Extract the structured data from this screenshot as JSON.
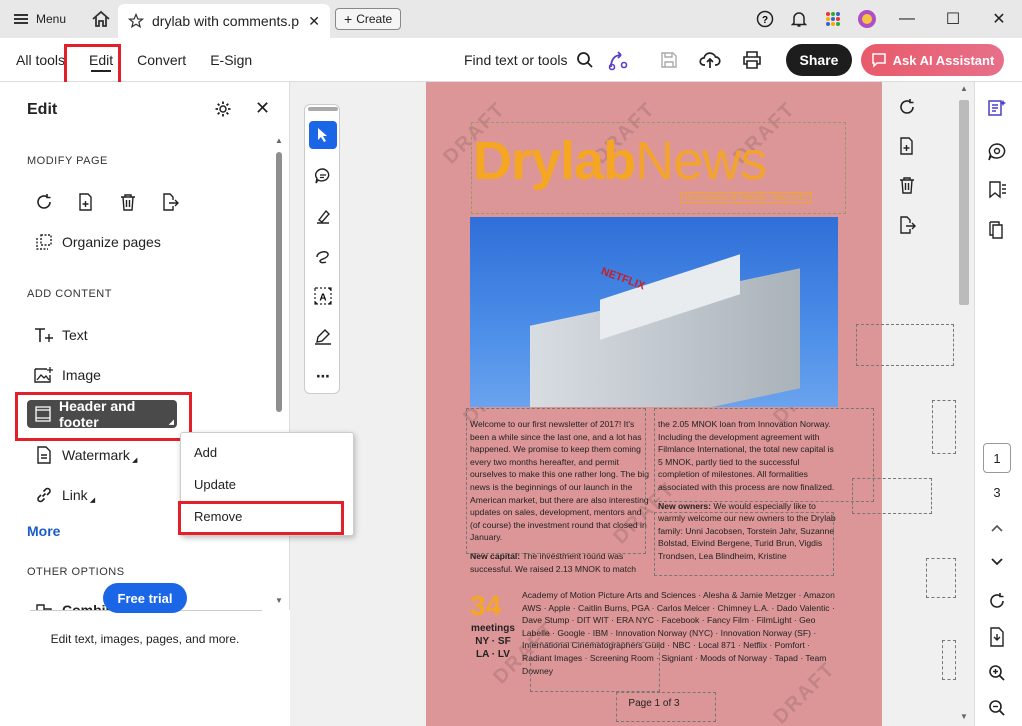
{
  "titlebar": {
    "menu_label": "Menu",
    "tab_title": "drylab with comments.p...",
    "create_label": "Create"
  },
  "toolbar": {
    "tabs": [
      "All tools",
      "Edit",
      "Convert",
      "E-Sign"
    ],
    "find_label": "Find text or tools",
    "share_label": "Share",
    "ai_label": "Ask AI Assistant"
  },
  "left_panel": {
    "title": "Edit",
    "modify_label": "MODIFY PAGE",
    "organize_label": "Organize pages",
    "add_label": "ADD CONTENT",
    "text_label": "Text",
    "image_label": "Image",
    "header_footer_label": "Header and footer",
    "watermark_label": "Watermark",
    "link_label": "Link",
    "more_label": "More",
    "other_label": "OTHER OPTIONS",
    "combine_label": "Combine files",
    "footer_text": "Edit text, images, pages, and more.",
    "trial_label": "Free trial"
  },
  "context_menu": {
    "add": "Add",
    "update": "Update",
    "remove": "Remove"
  },
  "document": {
    "mast_dry": "Drylab",
    "mast_news": "News",
    "mast_sub": "for Investors & Friends · May 2017",
    "col1": "Welcome to our first newsletter of 2017! It's been a while since the last one, and a lot has happened. We promise to keep them coming every two months hereafter, and permit ourselves to make this one rather long. The big news is the beginnings of our launch in the American market, but there are also interesting updates on sales, development, mentors and (of course) the investment round that closed in January.",
    "col1b_bold": "New capital:",
    "col1b": " The investment round was successful. We raised 2.13 MNOK to match",
    "col2": "the 2.05 MNOK loan from Innovation Norway. Including the development agreement with Filmlance International, the total new capital is 5 MNOK, partly tied to the successful completion of milestones. All formalities associated with this process are now finalized.",
    "col2b_bold": "New owners:",
    "col2b": " We would especially like to warmly welcome our new owners to the Drylab family: Unni Jacobsen, Torstein Jahr, Suzanne Bolstad, Eivind Bergene, Turid Brun, Vigdis Trondsen, Lea Blindheim, Kristine",
    "big_num": "34",
    "meetings": "meetings",
    "cities1": "NY · SF",
    "cities2": "LA · LV",
    "col3": "Academy of Motion Picture Arts and Sciences · Alesha & Jamie Metzger · Amazon AWS · Apple · Caitlin Burns, PGA · Carlos Melcer · Chimney L.A. · Dado Valentic · Dave Stump · DIT WIT · ERA NYC · Facebook · Fancy Film · FilmLight · Geo Labelle · Google · IBM · Innovation Norway (NYC) · Innovation Norway (SF) · International Cinematographers Guild · NBC · Local 871 · Netflix · Pomfort · Radiant Images · Screening Room · Signiant · Moods of Norway · Tapad · Team Downey",
    "netflix": "NETFLIX",
    "page_label": "Page 1 of 3",
    "draft": "DRAFT"
  },
  "page_nav": {
    "current": "1",
    "total": "3"
  },
  "colors": {
    "accent_red": "#e3202a",
    "brand_blue": "#1a66e6",
    "page_bg": "#dc9697",
    "mast_orange": "#f5a623"
  }
}
